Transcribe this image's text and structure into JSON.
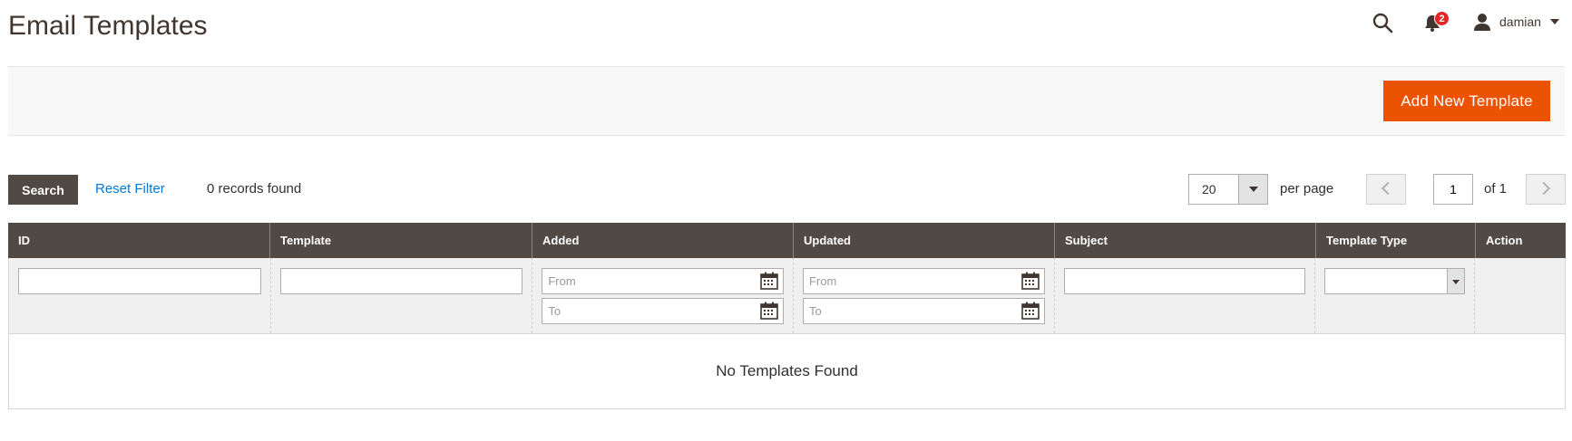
{
  "page": {
    "title": "Email Templates"
  },
  "header": {
    "notifications_count": "2",
    "user_name": "damian"
  },
  "actions": {
    "add_button": "Add New Template"
  },
  "toolbar": {
    "search_label": "Search",
    "reset_label": "Reset Filter",
    "records_text": "0 records found",
    "per_page_value": "20",
    "per_page_label": "per page",
    "current_page": "1",
    "of_text": "of 1"
  },
  "grid": {
    "columns": [
      "ID",
      "Template",
      "Added",
      "Updated",
      "Subject",
      "Template Type",
      "Action"
    ],
    "filters": {
      "from_placeholder": "From",
      "to_placeholder": "To"
    },
    "empty_text": "No Templates Found"
  },
  "colors": {
    "accent": "#eb5202",
    "header_bg": "#514943",
    "link": "#007bdb",
    "badge": "#e22626"
  }
}
